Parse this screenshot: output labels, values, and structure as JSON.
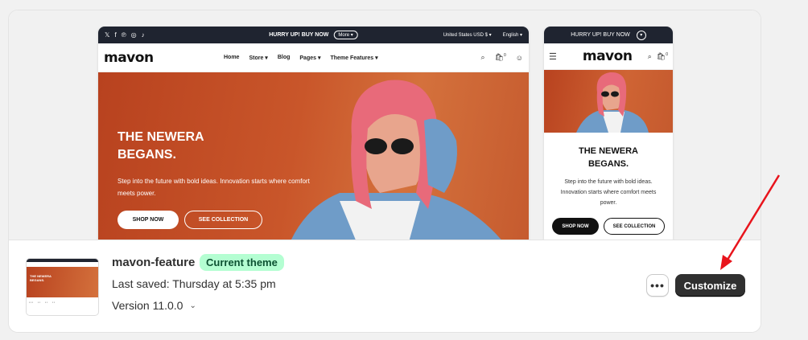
{
  "desktop_preview": {
    "announcement": {
      "social_icons": [
        "x-icon",
        "facebook-icon",
        "pinterest-icon",
        "instagram-icon",
        "tiktok-icon"
      ],
      "message": "HURRY UP! BUY NOW",
      "more_label": "More",
      "currency": "United States USD $",
      "language": "English"
    },
    "logo": "mavon",
    "nav": [
      "Home",
      "Store",
      "Blog",
      "Pages",
      "Theme Features"
    ],
    "cart_count": "0",
    "hero": {
      "title": "THE NEWERA BEGANS.",
      "text": "Step into the future with bold ideas. Innovation starts where comfort meets power.",
      "primary_button": "SHOP NOW",
      "secondary_button": "SEE COLLECTION"
    }
  },
  "mobile_preview": {
    "announcement": "HURRY UP! BUY NOW",
    "logo": "mavon",
    "cart_count": "0",
    "hero": {
      "title": "THE NEWERA BEGANS.",
      "text": "Step into the future with bold ideas. Innovation starts where comfort meets power.",
      "primary_button": "SHOP NOW",
      "secondary_button": "SEE COLLECTION"
    }
  },
  "theme": {
    "name": "mavon-feature",
    "badge": "Current theme",
    "last_saved": "Last saved: Thursday at 5:35 pm",
    "version": "Version 11.0.0",
    "more_actions_label": "•••",
    "customize_label": "Customize"
  },
  "colors": {
    "badge_bg": "#b4fed2",
    "customize_bg": "#303030",
    "hero_orange": "#c9562a",
    "arrow": "#e8141c"
  }
}
